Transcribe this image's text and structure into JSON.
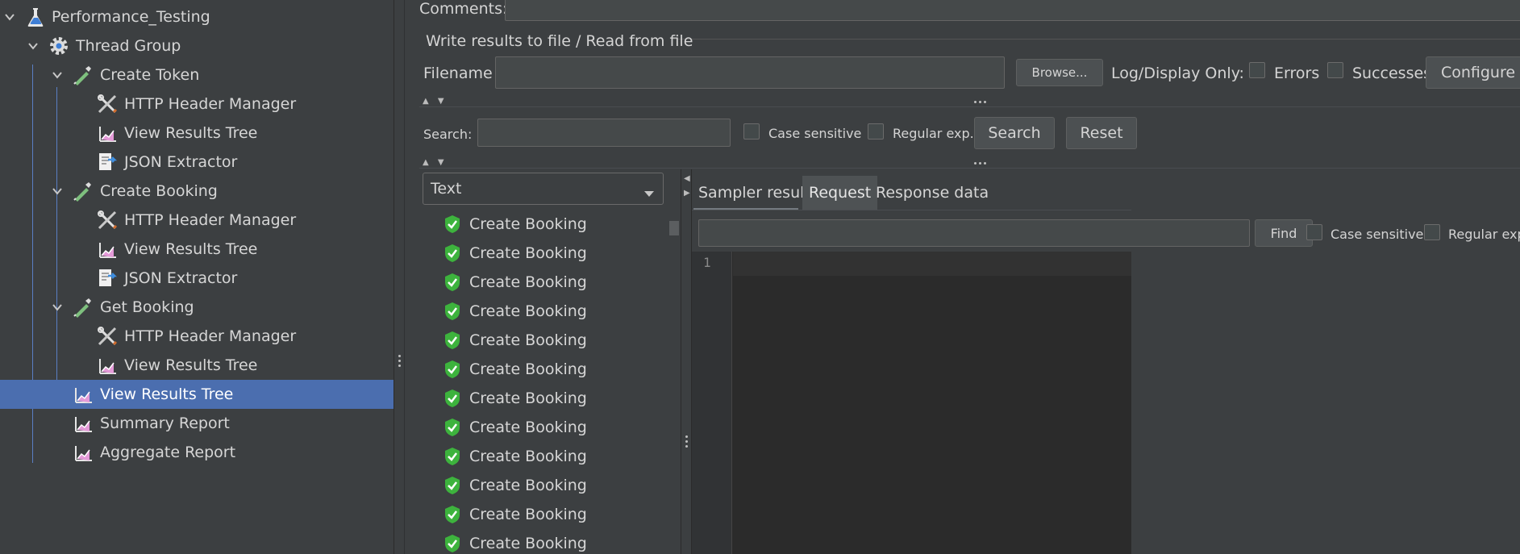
{
  "tree": {
    "items": [
      {
        "label": "Performance_Testing",
        "icon": "flask-icon",
        "expanded": true
      },
      {
        "label": "Thread Group",
        "icon": "gear-icon",
        "expanded": true
      },
      {
        "label": "Create Token",
        "icon": "pipette-sampler-icon",
        "expanded": true
      },
      {
        "label": "HTTP Header Manager",
        "icon": "wrench-screwdriver-icon"
      },
      {
        "label": "View Results Tree",
        "icon": "chart-listener-icon"
      },
      {
        "label": "JSON Extractor",
        "icon": "extractor-icon"
      },
      {
        "label": "Create Booking",
        "icon": "pipette-sampler-icon",
        "expanded": true
      },
      {
        "label": "HTTP Header Manager",
        "icon": "wrench-screwdriver-icon"
      },
      {
        "label": "View Results Tree",
        "icon": "chart-listener-icon"
      },
      {
        "label": "JSON Extractor",
        "icon": "extractor-icon"
      },
      {
        "label": "Get Booking",
        "icon": "pipette-sampler-icon",
        "expanded": true
      },
      {
        "label": "HTTP Header Manager",
        "icon": "wrench-screwdriver-icon"
      },
      {
        "label": "View Results Tree",
        "icon": "chart-listener-icon"
      },
      {
        "label": "View Results Tree",
        "icon": "chart-listener-icon",
        "selected": true
      },
      {
        "label": "Summary Report",
        "icon": "chart-listener-icon"
      },
      {
        "label": "Aggregate Report",
        "icon": "chart-listener-icon"
      }
    ]
  },
  "comments": {
    "label": "Comments:",
    "value": ""
  },
  "write_results": {
    "section_title": "Write results to file / Read from file",
    "filename_label": "Filename",
    "filename_value": "",
    "browse_label": "Browse...",
    "log_display_label": "Log/Display Only:",
    "errors_label": "Errors",
    "successes_label": "Successes",
    "configure_label": "Configure"
  },
  "search": {
    "label": "Search:",
    "value": "",
    "case_sensitive_label": "Case sensitive",
    "regex_label": "Regular exp.",
    "search_button": "Search",
    "reset_button": "Reset"
  },
  "results": {
    "renderer_selected": "Text",
    "items": [
      "Create Booking",
      "Create Booking",
      "Create Booking",
      "Create Booking",
      "Create Booking",
      "Create Booking",
      "Create Booking",
      "Create Booking",
      "Create Booking",
      "Create Booking",
      "Create Booking",
      "Create Booking"
    ]
  },
  "detail": {
    "tabs": [
      {
        "label": "Sampler result"
      },
      {
        "label": "Request",
        "active": true
      },
      {
        "label": "Response data"
      }
    ],
    "find_value": "",
    "find_button": "Find",
    "case_sensitive_label": "Case sensitive",
    "regex_label": "Regular exp.",
    "line_number": "1"
  },
  "colors": {
    "background": "#3c3f41",
    "selection": "#4b6eaf",
    "success_green": "#3db33d"
  }
}
